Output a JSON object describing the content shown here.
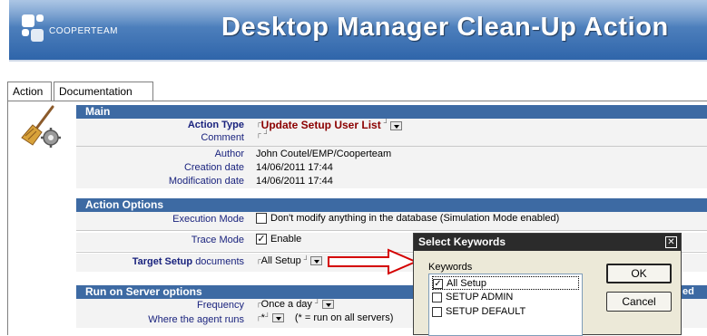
{
  "banner": {
    "logo_text": "COOPERTEAM",
    "title": "Desktop Manager Clean-Up Action"
  },
  "tabs": [
    {
      "label": "Action",
      "active": true
    },
    {
      "label": "Documentation",
      "active": false
    }
  ],
  "main": {
    "header": "Main",
    "action_type_label": "Action Type",
    "action_type_value": "Update Setup User List",
    "comment_label": "Comment",
    "author_label": "Author",
    "author_value": "John Coutel/EMP/Cooperteam",
    "creation_label": "Creation date",
    "creation_value": "14/06/2011 17:44",
    "modification_label": "Modification date",
    "modification_value": "14/06/2011 17:44"
  },
  "action_options": {
    "header": "Action Options",
    "execution_label": "Execution Mode",
    "execution_text": "Don't modify anything in the database (Simulation Mode enabled)",
    "execution_checked": false,
    "trace_label": "Trace Mode",
    "trace_text": "Enable",
    "trace_checked": true,
    "target_label": "Target Setup",
    "target_label_suffix": "documents",
    "target_value": "All Setup"
  },
  "server_options": {
    "header": "Run on Server options",
    "header_tail": "ed",
    "frequency_label": "Frequency",
    "frequency_value": "Once a day",
    "where_label": "Where the agent runs",
    "where_value": "*",
    "where_note": "(* = run on all servers)"
  },
  "dialog": {
    "title": "Select Keywords",
    "close_glyph": "✕",
    "keywords_label": "Keywords",
    "items": [
      {
        "label": "All Setup",
        "checked": true
      },
      {
        "label": "SETUP ADMIN",
        "checked": false
      },
      {
        "label": "SETUP DEFAULT",
        "checked": false
      }
    ],
    "ok_label": "OK",
    "cancel_label": "Cancel"
  },
  "icons": {
    "broom": "broom-icon",
    "arrow": "red-arrow-icon"
  },
  "colors": {
    "section_header": "#3d6aa3",
    "label_blue": "#1a237e",
    "action_type_red": "#8b0000",
    "arrow_red": "#d40000"
  }
}
